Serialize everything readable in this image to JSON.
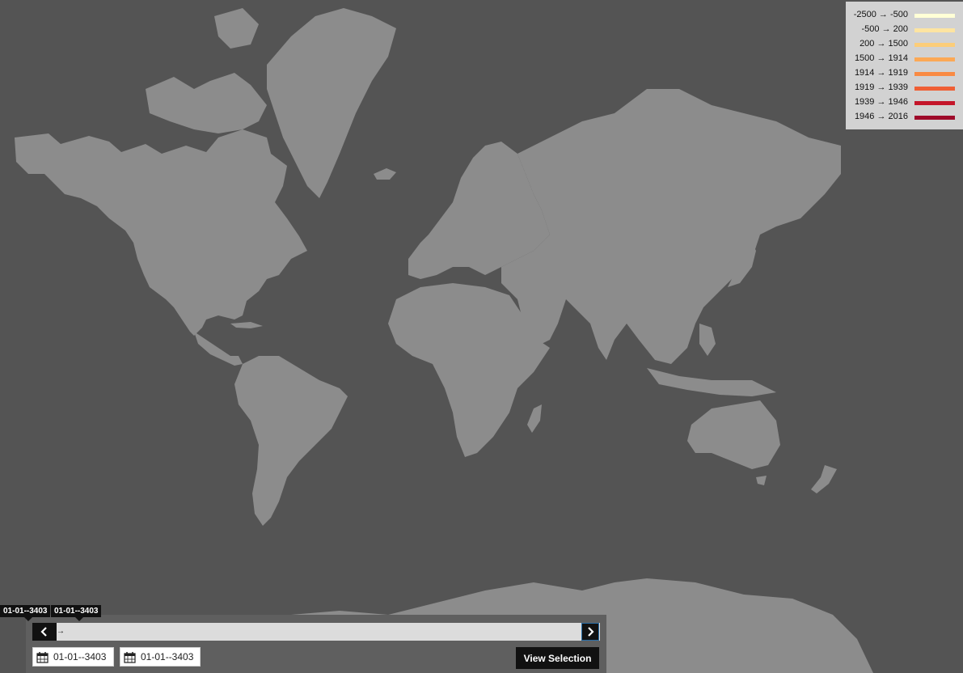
{
  "legend": {
    "items": [
      {
        "label": "-2500 → -500",
        "color": "#ffffd6"
      },
      {
        "label": "-500 → 200",
        "color": "#fde4a1"
      },
      {
        "label": "200 → 1500",
        "color": "#fccd79"
      },
      {
        "label": "1500 → 1914",
        "color": "#fca855"
      },
      {
        "label": "1914 → 1919",
        "color": "#f98a43"
      },
      {
        "label": "1919 → 1939",
        "color": "#ef5f35"
      },
      {
        "label": "1939 → 1946",
        "color": "#c4162a"
      },
      {
        "label": "1946 → 2016",
        "color": "#9e0a2a"
      }
    ]
  },
  "timeline": {
    "tooltip_start": "01-01--3403",
    "tooltip_end": "01-01--3403",
    "start_date": "01-01--3403",
    "end_date": "01-01--3403",
    "view_selection_label": "View Selection",
    "prev_icon": "chevron-left-icon",
    "next_icon": "chevron-right-icon",
    "calendar_icon": "calendar-icon"
  },
  "map": {
    "background": "#545454",
    "land": "#8c8c8c"
  }
}
